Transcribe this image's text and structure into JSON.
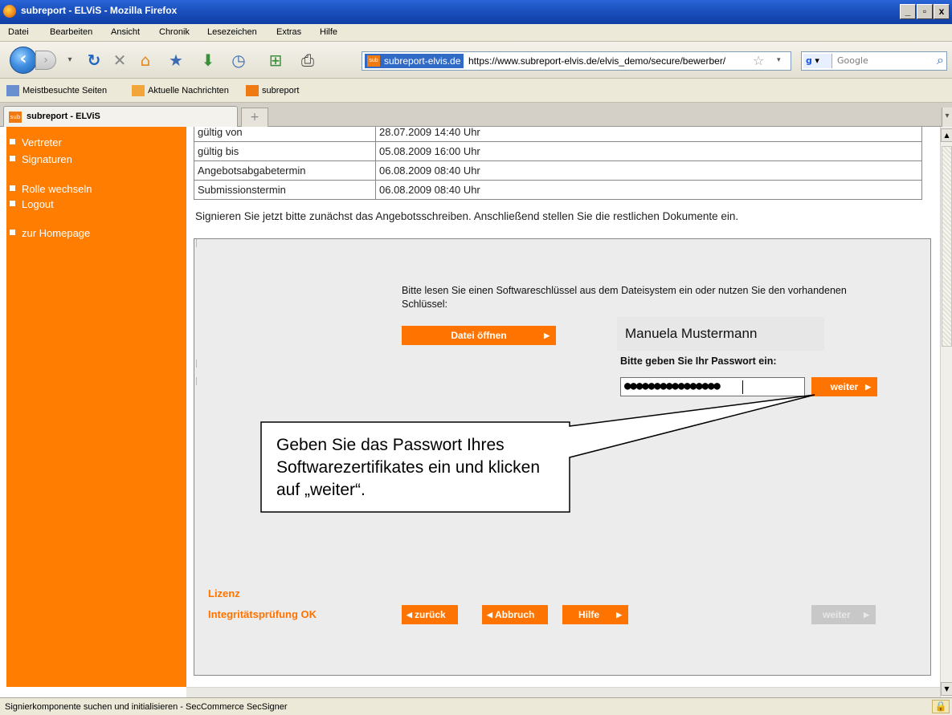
{
  "window": {
    "title": "subreport - ELViS - Mozilla Firefox",
    "buttons": {
      "minimize": "_",
      "maximize": "▫",
      "close": "x"
    }
  },
  "menubar": [
    "Datei",
    "Bearbeiten",
    "Ansicht",
    "Chronik",
    "Lesezeichen",
    "Extras",
    "Hilfe"
  ],
  "toolbar": {
    "site_identity": "subreport-elvis.de",
    "url": "https://www.subreport-elvis.de/elvis_demo/secure/bewerber/",
    "search_placeholder": "Google"
  },
  "bookmarks": [
    "Meistbesuchte Seiten",
    "Aktuelle Nachrichten",
    "subreport"
  ],
  "tab": {
    "label": "subreport - ELViS"
  },
  "sidebar": {
    "items": [
      "Vertreter",
      "Signaturen",
      "Rolle wechseln",
      "Logout",
      "zur Homepage"
    ]
  },
  "info_table": [
    {
      "label": "gültig von",
      "value": "28.07.2009 14:40 Uhr"
    },
    {
      "label": "gültig bis",
      "value": "05.08.2009 16:00 Uhr"
    },
    {
      "label": "Angebotsabgabetermin",
      "value": "06.08.2009 08:40 Uhr"
    },
    {
      "label": "Submissionstermin",
      "value": "06.08.2009 08:40 Uhr"
    }
  ],
  "instruction": "Signieren Sie jetzt bitte zunächst das Angebotsschreiben. Anschließend stellen Sie die restlichen Dokumente ein.",
  "applet": {
    "read_text": "Bitte lesen Sie einen Softwareschlüssel aus dem Dateisystem ein oder nutzen Sie den vorhandenen Schlüssel:",
    "open_file_label": "Datei öffnen",
    "holder_name": "Manuela Mustermann",
    "password_label": "Bitte geben Sie Ihr Passwort ein:",
    "password_mask": "●●●●●●●●●●●●●●●●",
    "weiter_label": "weiter",
    "callout": "Geben Sie das Passwort Ihres Softwarezertifikates ein und klicken auf „weiter“.",
    "license_label": "Lizenz",
    "integrity_label": "Integritätsprüfung OK",
    "back_label": "zurück",
    "abort_label": "Abbruch",
    "help_label": "Hilfe",
    "next_label": "weiter"
  },
  "statusbar": "Signierkomponente suchen und initialisieren  - SecCommerce SecSigner",
  "colors": {
    "accent": "#ff7d00",
    "button": "#ff7300",
    "titlebar": "#1c52c0"
  }
}
